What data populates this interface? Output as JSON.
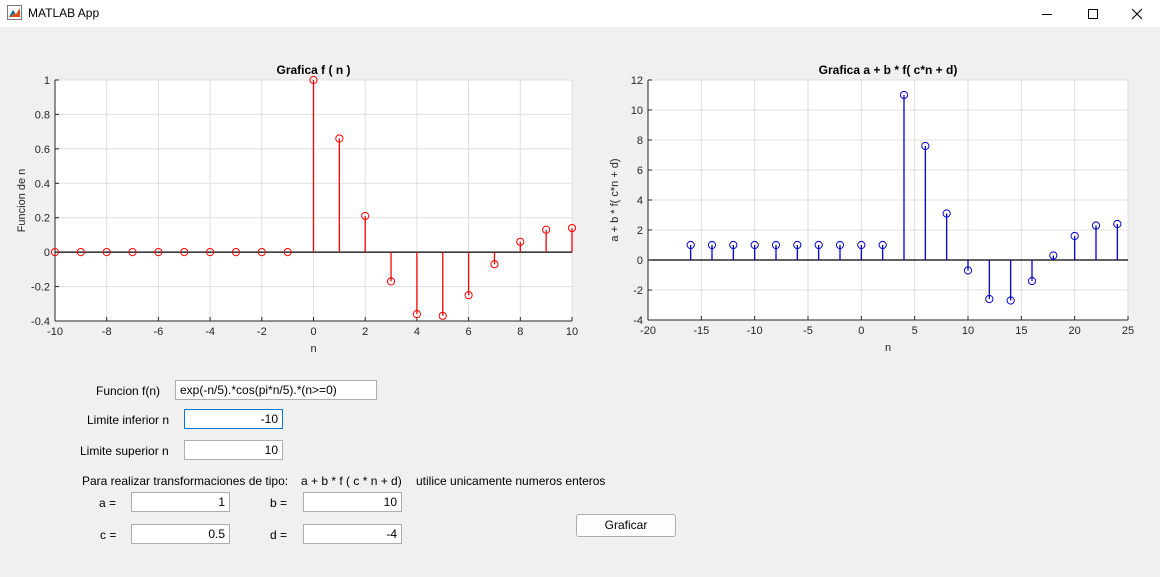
{
  "window": {
    "title": "MATLAB App",
    "icon": "matlab-app-icon"
  },
  "plots": [
    {
      "id": "left",
      "title": "Grafica f ( n )",
      "xlabel": "n",
      "ylabel": "Funcion de n",
      "color": "#ff0000",
      "marker": "circle",
      "xlim": [
        -10,
        10
      ],
      "ylim": [
        -0.4,
        1
      ],
      "xticks": [
        -10,
        -8,
        -6,
        -4,
        -2,
        0,
        2,
        4,
        6,
        8,
        10
      ],
      "yticks": [
        -0.4,
        -0.2,
        0,
        0.2,
        0.4,
        0.6,
        0.8,
        1
      ],
      "ytick_labels": [
        "-0.4",
        "-0.2",
        "0",
        "0.2",
        "0.4",
        "0.6",
        "0.8",
        "1"
      ],
      "grid": true
    },
    {
      "id": "right",
      "title": "Grafica a + b * f( c*n + d)",
      "xlabel": "n",
      "ylabel": "a + b * f( c*n + d)",
      "color": "#0000cc",
      "marker": "circle",
      "xlim": [
        -20,
        25
      ],
      "ylim": [
        -4,
        12
      ],
      "xticks": [
        -20,
        -15,
        -10,
        -5,
        0,
        5,
        10,
        15,
        20,
        25
      ],
      "yticks": [
        -4,
        -2,
        0,
        2,
        4,
        6,
        8,
        10,
        12
      ],
      "ytick_labels": [
        "-4",
        "-2",
        "0",
        "2",
        "4",
        "6",
        "8",
        "10",
        "12"
      ],
      "grid": true
    }
  ],
  "chart_data": [
    {
      "type": "stem",
      "title": "Grafica f ( n )",
      "xlabel": "n",
      "ylabel": "Funcion de n",
      "xlim": [
        -10,
        10
      ],
      "ylim": [
        -0.4,
        1
      ],
      "x": [
        -10,
        -9,
        -8,
        -7,
        -6,
        -5,
        -4,
        -3,
        -2,
        -1,
        0,
        1,
        2,
        3,
        4,
        5,
        6,
        7,
        8,
        9,
        10
      ],
      "y": [
        0,
        0,
        0,
        0,
        0,
        0,
        0,
        0,
        0,
        0,
        1,
        0.66,
        0.21,
        -0.17,
        -0.36,
        -0.37,
        -0.25,
        -0.07,
        0.06,
        0.13,
        0.14
      ]
    },
    {
      "type": "stem",
      "title": "Grafica a + b * f( c*n + d)",
      "xlabel": "n",
      "ylabel": "a + b * f( c*n + d)",
      "xlim": [
        -20,
        25
      ],
      "ylim": [
        -4,
        12
      ],
      "x": [
        -16,
        -14,
        -12,
        -10,
        -8,
        -6,
        -4,
        -2,
        0,
        2,
        4,
        6,
        8,
        10,
        12,
        14,
        16,
        18,
        20,
        22,
        24
      ],
      "y": [
        1,
        1,
        1,
        1,
        1,
        1,
        1,
        1,
        1,
        1,
        11,
        7.6,
        3.1,
        -0.7,
        -2.6,
        -2.7,
        -1.4,
        0.3,
        1.6,
        2.3,
        2.4
      ]
    }
  ],
  "form": {
    "funcion_label": "Funcion f(n)",
    "funcion_value": "exp(-n/5).*cos(pi*n/5).*(n>=0)",
    "lim_inf_label": "Limite inferior n",
    "lim_inf_value": "-10",
    "lim_sup_label": "Limite superior n",
    "lim_sup_value": "10",
    "transform_label": "Para realizar transformaciones de tipo:",
    "transform_formula": "a + b * f ( c * n + d)",
    "transform_note": "utilice unicamente numeros enteros",
    "a_label": "a =",
    "a_value": "1",
    "b_label": "b =",
    "b_value": "10",
    "c_label": "c =",
    "c_value": "0.5",
    "d_label": "d =",
    "d_value": "-4",
    "graficar_label": "Graficar"
  }
}
